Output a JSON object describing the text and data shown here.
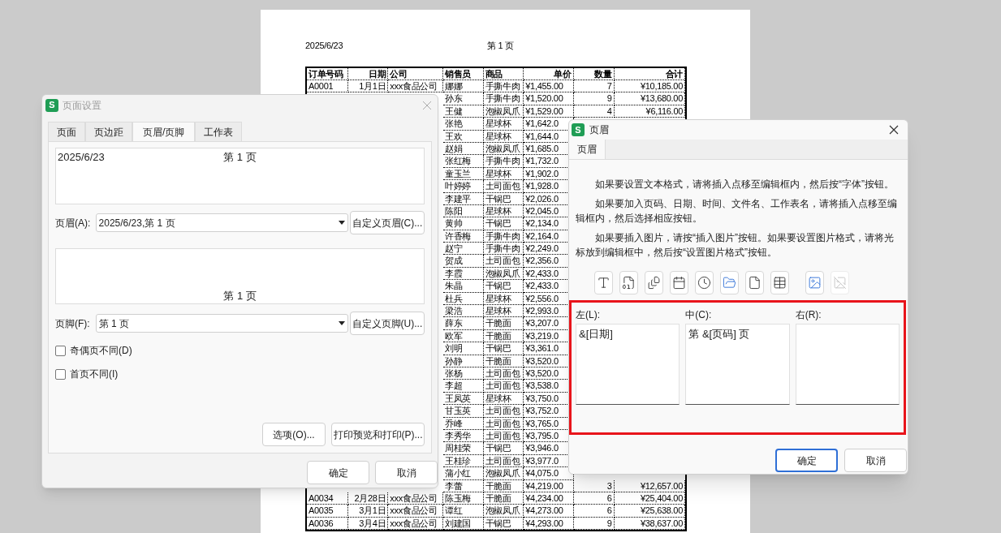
{
  "sheet": {
    "header_date": "2025/6/23",
    "header_page": "第 1 页",
    "columns": [
      "订单号码",
      "日期",
      "公司",
      "销售员",
      "商品",
      "单价",
      "数量",
      "合计"
    ],
    "rows": [
      {
        "order": "A0001",
        "date": "1月1日",
        "company": "xxx食品公司",
        "seller": "娜娜",
        "product": "手撕牛肉",
        "price": "¥1,455.00",
        "qty": "7",
        "total": "¥10,185.00"
      },
      {
        "seller": "孙东",
        "product": "手撕牛肉",
        "price": "¥1,520.00",
        "qty": "9",
        "total": "¥13,680.00"
      },
      {
        "seller": "王健",
        "product": "泡椒凤爪",
        "price": "¥1,529.00",
        "qty": "4",
        "total": "¥6,116.00"
      },
      {
        "seller": "张艳",
        "product": "星球杯",
        "price": "¥1,642.0"
      },
      {
        "seller": "王欢",
        "product": "星球杯",
        "price": "¥1,644.0"
      },
      {
        "seller": "赵娟",
        "product": "泡椒凤爪",
        "price": "¥1,685.0"
      },
      {
        "seller": "张红梅",
        "product": "手撕牛肉",
        "price": "¥1,732.0"
      },
      {
        "seller": "童玉兰",
        "product": "星球杯",
        "price": "¥1,902.0"
      },
      {
        "seller": "叶婷婷",
        "product": "土司面包",
        "price": "¥1,928.0"
      },
      {
        "seller": "李建平",
        "product": "干锅巴",
        "price": "¥2,026.0"
      },
      {
        "seller": "陈阳",
        "product": "星球杯",
        "price": "¥2,045.0"
      },
      {
        "seller": "黄帅",
        "product": "干锅巴",
        "price": "¥2,134.0"
      },
      {
        "seller": "许香梅",
        "product": "手撕牛肉",
        "price": "¥2,164.0"
      },
      {
        "seller": "赵宁",
        "product": "手撕牛肉",
        "price": "¥2,249.0"
      },
      {
        "seller": "贺成",
        "product": "土司面包",
        "price": "¥2,356.0"
      },
      {
        "seller": "李霞",
        "product": "泡椒凤爪",
        "price": "¥2,433.0"
      },
      {
        "seller": "朱晶",
        "product": "干锅巴",
        "price": "¥2,433.0"
      },
      {
        "seller": "杜兵",
        "product": "星球杯",
        "price": "¥2,556.0"
      },
      {
        "seller": "梁浩",
        "product": "星球杯",
        "price": "¥2,993.0"
      },
      {
        "seller": "薛东",
        "product": "干脆面",
        "price": "¥3,207.0"
      },
      {
        "seller": "欧军",
        "product": "干脆面",
        "price": "¥3,219.0"
      },
      {
        "seller": "刘明",
        "product": "干锅巴",
        "price": "¥3,361.0"
      },
      {
        "seller": "孙静",
        "product": "干脆面",
        "price": "¥3,520.0"
      },
      {
        "seller": "张杨",
        "product": "土司面包",
        "price": "¥3,520.0"
      },
      {
        "seller": "李超",
        "product": "土司面包",
        "price": "¥3,538.0"
      },
      {
        "seller": "王凤英",
        "product": "星球杯",
        "price": "¥3,750.0"
      },
      {
        "seller": "甘玉英",
        "product": "土司面包",
        "price": "¥3,752.0"
      },
      {
        "seller": "乔峰",
        "product": "土司面包",
        "price": "¥3,765.0"
      },
      {
        "seller": "李秀华",
        "product": "土司面包",
        "price": "¥3,795.0"
      },
      {
        "seller": "周桂荣",
        "product": "干锅巴",
        "price": "¥3,946.0"
      },
      {
        "seller": "王桂珍",
        "product": "土司面包",
        "price": "¥3,977.0"
      },
      {
        "seller": "蒲小红",
        "product": "泡椒凤爪",
        "price": "¥4,075.0"
      },
      {
        "seller": "李蕾",
        "product": "干脆面",
        "price": "¥4,219.00",
        "qty": "3",
        "total": "¥12,657.00"
      },
      {
        "order": "A0034",
        "date": "2月28日",
        "company": "xxx食品公司",
        "seller": "陈玉梅",
        "product": "干脆面",
        "price": "¥4,234.00",
        "qty": "6",
        "total": "¥25,404.00"
      },
      {
        "order": "A0035",
        "date": "3月1日",
        "company": "xxx食品公司",
        "seller": "谭红",
        "product": "泡椒凤爪",
        "price": "¥4,273.00",
        "qty": "6",
        "total": "¥25,638.00"
      },
      {
        "order": "A0036",
        "date": "3月4日",
        "company": "xxx食品公司",
        "seller": "刘建国",
        "product": "干锅巴",
        "price": "¥4,293.00",
        "qty": "9",
        "total": "¥38,637.00"
      }
    ]
  },
  "page_setup": {
    "app_icon": "S",
    "title": "页面设置",
    "active": false,
    "tabs": [
      {
        "label": "页面",
        "selected": false
      },
      {
        "label": "页边距",
        "selected": false
      },
      {
        "label": "页眉/页脚",
        "selected": true
      },
      {
        "label": "工作表",
        "selected": false
      }
    ],
    "header_preview": {
      "left": "2025/6/23",
      "center": "第 1 页"
    },
    "header_label": "页眉(A):",
    "header_value": "2025/6/23,第 1 页",
    "header_button": "自定义页眉(C)...",
    "footer_preview": {
      "center": "第 1 页"
    },
    "footer_label": "页脚(F):",
    "footer_value": "第 1 页",
    "footer_button": "自定义页脚(U)...",
    "checkboxes": [
      {
        "label": "奇偶页不同(D)",
        "checked": false
      },
      {
        "label": "首页不同(I)",
        "checked": false
      }
    ],
    "panel_buttons": [
      "选项(O)...",
      "打印预览和打印(P)..."
    ],
    "buttons": [
      "确定",
      "取消"
    ]
  },
  "header_dialog": {
    "app_icon": "S",
    "title": "页眉",
    "active": true,
    "tabs": [
      {
        "label": "页眉",
        "selected": true
      }
    ],
    "paragraphs": [
      "如果要设置文本格式，请将插入点移至编辑框内，然后按“字体”按钮。",
      "如果要加入页码、日期、时间、文件名、工作表名，请将插入点移至编辑框内，然后选择相应按钮。",
      "如果要插入图片，请按“插入图片”按钮。如果要设置图片格式，请将光标放到编辑框中，然后按“设置图片格式”按钮。"
    ],
    "tools": [
      {
        "kind": "font",
        "disabled": false
      },
      {
        "kind": "page",
        "disabled": false
      },
      {
        "kind": "pages",
        "disabled": false
      },
      {
        "kind": "date",
        "disabled": false
      },
      {
        "kind": "time",
        "disabled": false
      },
      {
        "kind": "path",
        "disabled": false
      },
      {
        "kind": "file",
        "disabled": false
      },
      {
        "kind": "sheet",
        "disabled": false
      },
      {
        "kind": "image",
        "disabled": false
      },
      {
        "kind": "image_format",
        "disabled": true
      }
    ],
    "sections": [
      {
        "label": "左(L):",
        "value": "&[日期]"
      },
      {
        "label": "中(C):",
        "value": "第 &[页码] 页"
      },
      {
        "label": "右(R):"
      }
    ],
    "buttons": [
      {
        "label": "确定",
        "default": true
      },
      {
        "label": "取消",
        "default": false
      }
    ]
  }
}
